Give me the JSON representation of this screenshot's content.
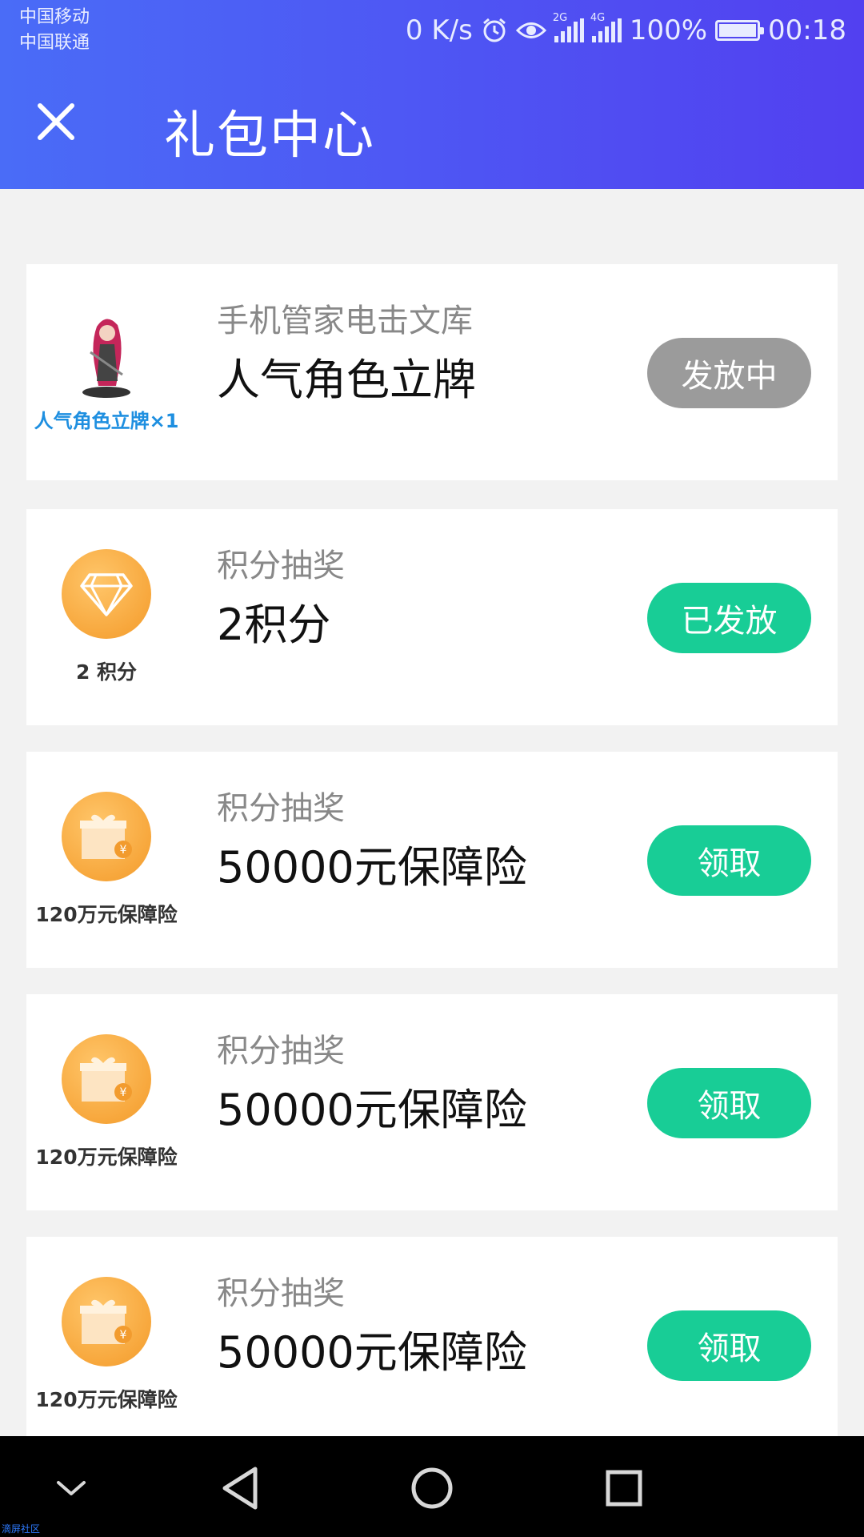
{
  "status_bar": {
    "carrier_1": "中国移动",
    "carrier_2": "中国联通",
    "net_speed": "0 K/s",
    "sim1_type": "2G",
    "sim2_type": "4G",
    "battery_percent": "100%",
    "time": "00:18"
  },
  "header": {
    "title": "礼包中心"
  },
  "cards": [
    {
      "thumb_caption": "人气角色立牌×1",
      "subtitle": "手机管家电击文库",
      "title": "人气角色立牌",
      "button": "发放中",
      "button_style": "gray"
    },
    {
      "thumb_caption": "2 积分",
      "subtitle": "积分抽奖",
      "title": "2积分",
      "button": "已发放",
      "button_style": "green"
    },
    {
      "thumb_caption": "120万元保障险",
      "subtitle": "积分抽奖",
      "title": "50000元保障险",
      "button": "领取",
      "button_style": "green"
    },
    {
      "thumb_caption": "120万元保障险",
      "subtitle": "积分抽奖",
      "title": "50000元保障险",
      "button": "领取",
      "button_style": "green"
    },
    {
      "thumb_caption": "120万元保障险",
      "subtitle": "积分抽奖",
      "title": "50000元保障险",
      "button": "领取",
      "button_style": "green"
    }
  ],
  "navbar": {
    "icons": [
      "chevron-down-icon",
      "back-icon",
      "home-icon",
      "recents-icon"
    ]
  },
  "watermark": "滴屏社区",
  "colors": {
    "header_start": "#4a6cf7",
    "header_end": "#5240f0",
    "button_green": "#18cd96",
    "button_gray": "#9b9b9b",
    "coin_orange": "#f7a73c"
  }
}
